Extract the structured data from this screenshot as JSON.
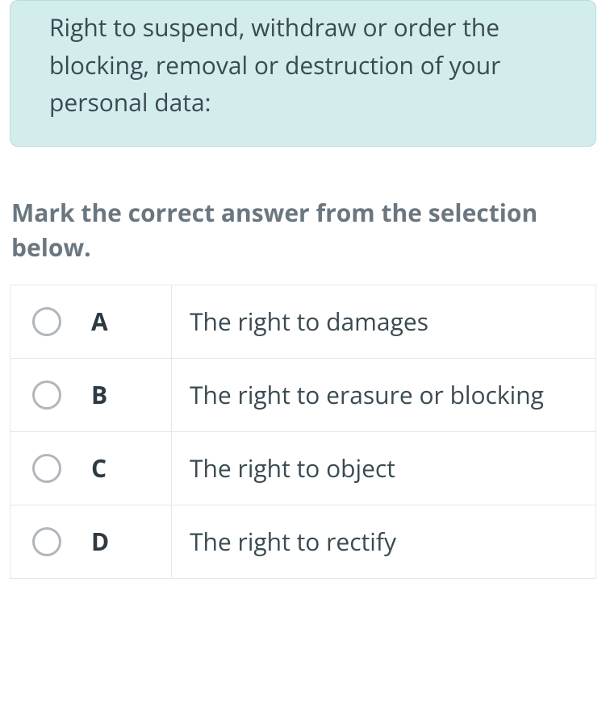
{
  "question": {
    "text": "Right to suspend, withdraw or order the blocking, removal or destruction of your personal data:"
  },
  "instruction": "Mark the correct answer from the selection below.",
  "options": [
    {
      "letter": "A",
      "text": "The right to damages"
    },
    {
      "letter": "B",
      "text": "The right to erasure or blocking"
    },
    {
      "letter": "C",
      "text": "The right to object"
    },
    {
      "letter": "D",
      "text": "The right to rectify"
    }
  ]
}
